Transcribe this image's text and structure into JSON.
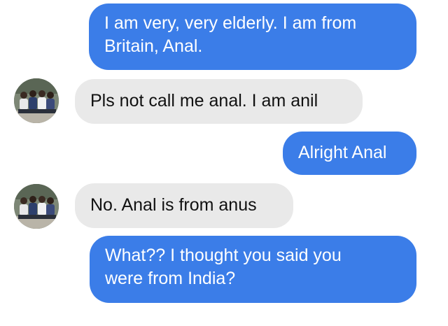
{
  "conversation": {
    "messages": [
      {
        "direction": "outgoing",
        "lines": [
          "I am very, very elderly. I am from",
          "Britain, Anal."
        ]
      },
      {
        "direction": "incoming",
        "lines": [
          "Pls not call me anal. I am anil"
        ]
      },
      {
        "direction": "outgoing",
        "lines": [
          "Alright Anal"
        ]
      },
      {
        "direction": "incoming",
        "lines": [
          "No. Anal is from anus"
        ]
      },
      {
        "direction": "outgoing",
        "lines": [
          "What?? I thought you said you",
          "were from India?"
        ]
      }
    ]
  },
  "colors": {
    "outgoing_bubble": "#3b7de8",
    "incoming_bubble": "#e9e9e9",
    "outgoing_text": "#ffffff",
    "incoming_text": "#111111",
    "background": "#ffffff"
  },
  "icons": {
    "contact_avatar": "group-photo-avatar"
  }
}
